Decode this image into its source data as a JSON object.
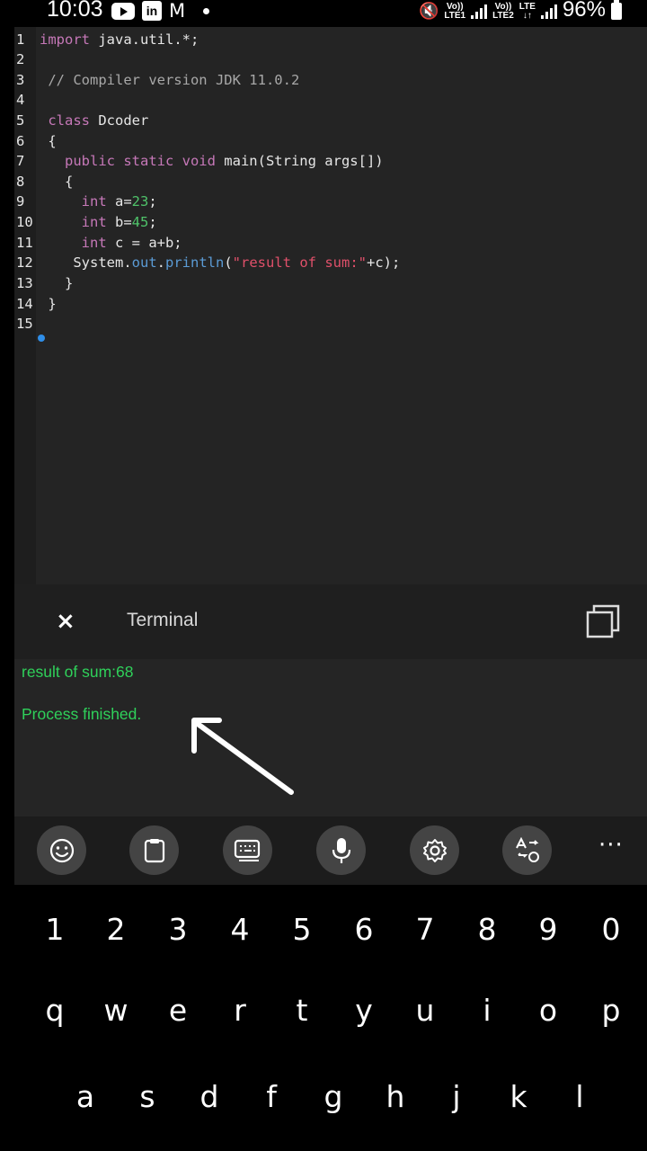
{
  "status_bar": {
    "time": "10:03",
    "icons": [
      "youtube-icon",
      "linkedin-icon",
      "gmail-icon",
      "notification-dot"
    ],
    "linkedin_glyph": "in",
    "gmail_glyph": "M",
    "net1_top": "Vo))",
    "net1_bottom": "LTE1",
    "net2_top": "Vo))",
    "net2_bottom": "LTE2",
    "lte_top": "LTE",
    "lte_bottom": "↓↑",
    "battery": "96%"
  },
  "editor": {
    "line_numbers": [
      "1",
      "2",
      "3",
      "4",
      "5",
      "6",
      "7",
      "8",
      "9",
      "10",
      "11",
      "12",
      "13",
      "14",
      "15"
    ],
    "code": {
      "l1_kw": "import",
      "l1_rest": " java.util.*;",
      "l3": " // Compiler version JDK 11.0.2",
      "l5_kw": " class",
      "l5_rest": " Dcoder",
      "l6": " {",
      "l7_kw": "   public static void",
      "l7_rest": " main(String args[])",
      "l8": "   {",
      "l9_kw": "     int",
      "l9_mid": " a=",
      "l9_num": "23",
      "l9_end": ";",
      "l10_kw": "     int",
      "l10_mid": " b=",
      "l10_num": "45",
      "l10_end": ";",
      "l11_kw": "     int",
      "l11_rest": " c = a+b;",
      "l12_a": "    System.",
      "l12_out": "out",
      "l12_dot": ".",
      "l12_fn": "println",
      "l12_paren": "(",
      "l12_str": "\"result of sum:\"",
      "l12_end": "+c);",
      "l13": "   }",
      "l14": " }"
    }
  },
  "terminal": {
    "title": "Terminal",
    "close_glyph": "×",
    "output": [
      "result of sum:68",
      "Process finished."
    ]
  },
  "toolbar": {
    "buttons": [
      "emoji-icon",
      "clipboard-icon",
      "keyboard-icon",
      "microphone-icon",
      "settings-icon",
      "translate-icon"
    ],
    "more_glyph": "···"
  },
  "keyboard": {
    "row1": [
      "1",
      "2",
      "3",
      "4",
      "5",
      "6",
      "7",
      "8",
      "9",
      "0"
    ],
    "row2": [
      "q",
      "w",
      "e",
      "r",
      "t",
      "y",
      "u",
      "i",
      "o",
      "p"
    ],
    "row3": [
      "a",
      "s",
      "d",
      "f",
      "g",
      "h",
      "j",
      "k",
      "l"
    ]
  }
}
